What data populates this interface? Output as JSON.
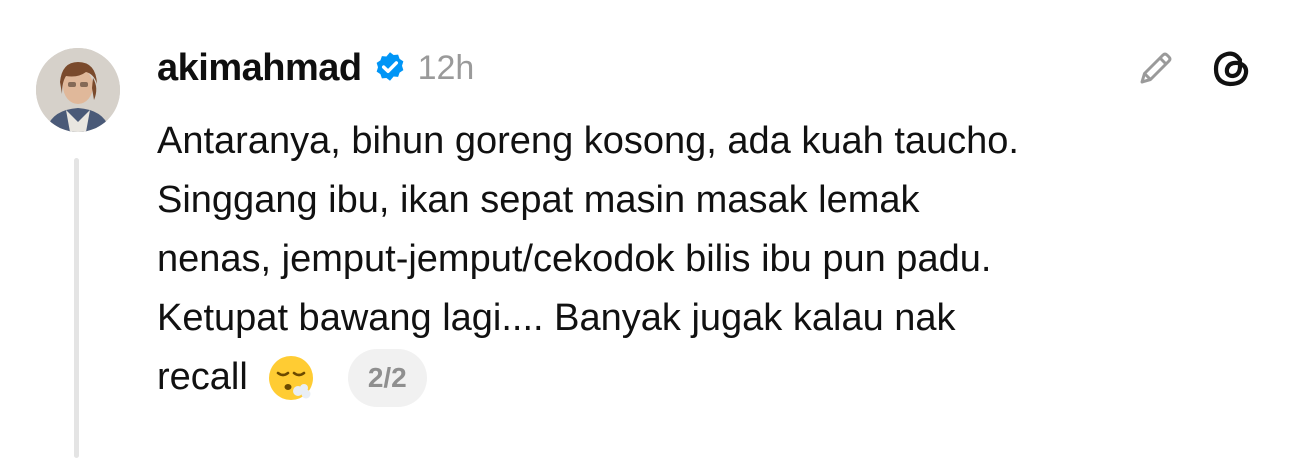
{
  "post": {
    "username": "akimahmad",
    "verified_icon": "verified-badge-icon",
    "timestamp": "12h",
    "lines": [
      "Antaranya, bihun goreng kosong, ada kuah taucho.",
      "Singgang ibu, ikan sepat masin masak lemak",
      "nenas, jemput-jemput/cekodok bilis ibu pun padu.",
      "Ketupat bawang lagi.... Banyak jugak kalau nak"
    ],
    "last_line_text": "recall",
    "emoji_icon": "face-exhaling-emoji",
    "page_indicator": "2/2"
  },
  "actions": {
    "edit_icon": "pencil-icon",
    "app_icon": "threads-logo-icon"
  },
  "colors": {
    "verified_blue": "#0095f6",
    "muted_gray": "#9a9a9a",
    "thread_line": "#e4e4e4"
  }
}
